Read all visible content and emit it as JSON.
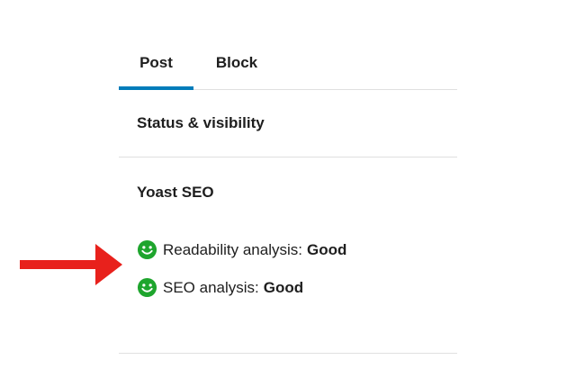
{
  "tabs": [
    {
      "label": "Post",
      "active": true
    },
    {
      "label": "Block",
      "active": false
    }
  ],
  "sections": {
    "status": {
      "title": "Status & visibility"
    },
    "yoast": {
      "title": "Yoast SEO",
      "readability": {
        "label": "Readability analysis:",
        "value": "Good",
        "icon": "smiley-good-icon"
      },
      "seo": {
        "label": "SEO analysis:",
        "value": "Good",
        "icon": "smiley-good-icon"
      }
    }
  },
  "annotation": {
    "icon": "red-arrow-icon",
    "color": "#e8211c"
  },
  "colors": {
    "accent": "#007cba",
    "good": "#1ea52d",
    "divider": "#e0e0e0"
  }
}
